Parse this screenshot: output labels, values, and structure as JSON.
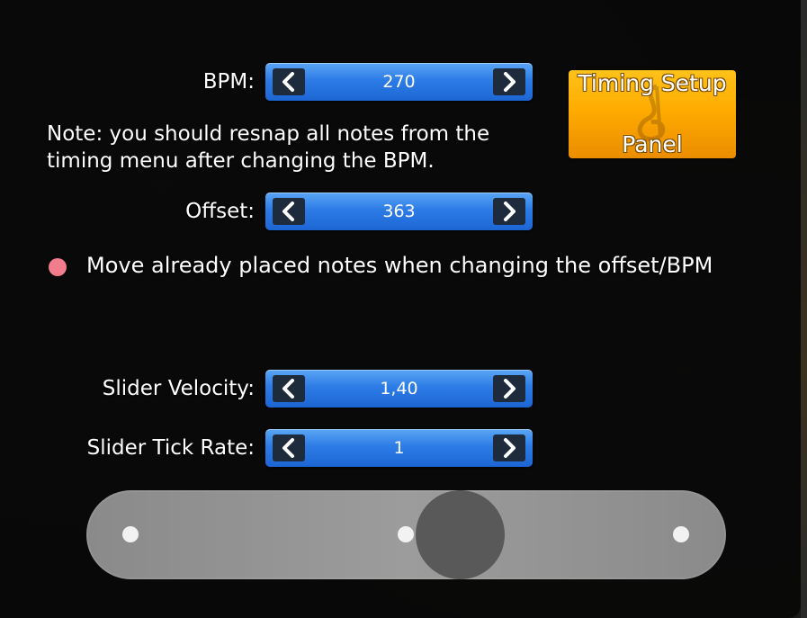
{
  "bpm": {
    "label": "BPM:",
    "value": "270"
  },
  "note_text": "Note: you should resnap all notes from the timing menu after changing the BPM.",
  "offset": {
    "label": "Offset:",
    "value": "363"
  },
  "timing_setup_button": {
    "line1": "Timing Setup",
    "line2": "Panel"
  },
  "move_notes_option": {
    "label": "Move already placed notes when changing the offset/BPM",
    "color": "#f07c8c"
  },
  "slider_velocity": {
    "label": "Slider Velocity:",
    "value": "1,40"
  },
  "slider_tick_rate": {
    "label": "Slider Tick Rate:",
    "value": "1"
  },
  "colors": {
    "stepper_blue": "#2d7ce6",
    "timing_orange": "#ffab00",
    "slider_track": "#9c9c9c",
    "slider_ball": "#595959"
  },
  "icons": [
    "chevron-left-icon",
    "chevron-right-icon",
    "music-note-icon"
  ]
}
